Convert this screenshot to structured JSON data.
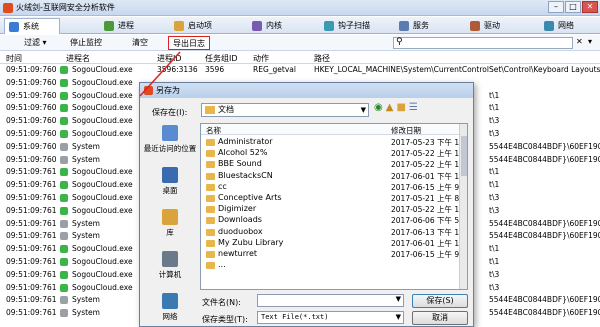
{
  "window": {
    "title": "火绒剑-互联网安全分析软件",
    "controls": [
      "–",
      "□",
      "✕"
    ]
  },
  "tabs": [
    {
      "label": "系统",
      "icon": "monitor-icon",
      "color": "#3a7bd5"
    },
    {
      "label": "进程",
      "icon": "process-icon",
      "color": "#4a9a3a"
    },
    {
      "label": "启动项",
      "icon": "startup-icon",
      "color": "#d9a43a"
    },
    {
      "label": "内核",
      "icon": "kernel-icon",
      "color": "#7a5ab0"
    },
    {
      "label": "钩子扫描",
      "icon": "hook-icon",
      "color": "#3a9ab0"
    },
    {
      "label": "服务",
      "icon": "service-icon",
      "color": "#5a7ab0"
    },
    {
      "label": "驱动",
      "icon": "driver-icon",
      "color": "#b05a3a"
    },
    {
      "label": "网络",
      "icon": "network-icon",
      "color": "#3a8ab0"
    }
  ],
  "toolbar": {
    "filter": "过滤 ▾",
    "stop": "停止监控",
    "clear": "清空",
    "export": "导出日志",
    "search_icon": "⚲",
    "search_clear": "✕",
    "search_options": "▾"
  },
  "columns": [
    "时间",
    "进程名",
    "进程ID",
    "任务组ID",
    "动作",
    "路径"
  ],
  "rows": [
    {
      "time": "09:51:09:760",
      "proc": "SogouCloud.exe",
      "pid": "3596:3136",
      "gid": "3596",
      "action": "REG_getval",
      "path": "HKEY_LOCAL_MACHINE\\System\\CurrentControlSet\\Control\\Keyboard Layouts\\",
      "icon": "#3bb54a"
    },
    {
      "time": "09:51:09:760",
      "proc": "SogouCloud.exe",
      "pid": "",
      "gid": "",
      "action": "",
      "path": "",
      "icon": "#3bb54a"
    },
    {
      "time": "09:51:09:760",
      "proc": "SogouCloud.exe",
      "pid": "",
      "gid": "",
      "action": "",
      "path": "t\\1",
      "icon": "#3bb54a"
    },
    {
      "time": "09:51:09:760",
      "proc": "SogouCloud.exe",
      "pid": "",
      "gid": "",
      "action": "",
      "path": "t\\1",
      "icon": "#3bb54a"
    },
    {
      "time": "09:51:09:760",
      "proc": "SogouCloud.exe",
      "pid": "",
      "gid": "",
      "action": "",
      "path": "t\\3",
      "icon": "#3bb54a"
    },
    {
      "time": "09:51:09:760",
      "proc": "SogouCloud.exe",
      "pid": "",
      "gid": "",
      "action": "",
      "path": "t\\3",
      "icon": "#3bb54a"
    },
    {
      "time": "09:51:09:760",
      "proc": "System",
      "pid": "",
      "gid": "",
      "action": "",
      "path": "5544E4BC0844BDF}\\60EF190592",
      "icon": "#9aa0a6"
    },
    {
      "time": "09:51:09:760",
      "proc": "System",
      "pid": "",
      "gid": "",
      "action": "",
      "path": "5544E4BC0844BDF}\\60EF190592",
      "icon": "#9aa0a6"
    },
    {
      "time": "09:51:09:761",
      "proc": "SogouCloud.exe",
      "pid": "",
      "gid": "",
      "action": "",
      "path": "t\\1",
      "icon": "#3bb54a"
    },
    {
      "time": "09:51:09:761",
      "proc": "SogouCloud.exe",
      "pid": "",
      "gid": "",
      "action": "",
      "path": "t\\1",
      "icon": "#3bb54a"
    },
    {
      "time": "09:51:09:761",
      "proc": "SogouCloud.exe",
      "pid": "",
      "gid": "",
      "action": "",
      "path": "t\\3",
      "icon": "#3bb54a"
    },
    {
      "time": "09:51:09:761",
      "proc": "SogouCloud.exe",
      "pid": "",
      "gid": "",
      "action": "",
      "path": "t\\3",
      "icon": "#3bb54a"
    },
    {
      "time": "09:51:09:761",
      "proc": "System",
      "pid": "",
      "gid": "",
      "action": "",
      "path": "5544E4BC0844BDF}\\60EF190592",
      "icon": "#9aa0a6"
    },
    {
      "time": "09:51:09:761",
      "proc": "System",
      "pid": "",
      "gid": "",
      "action": "",
      "path": "5544E4BC0844BDF}\\60EF190592",
      "icon": "#9aa0a6"
    },
    {
      "time": "09:51:09:761",
      "proc": "SogouCloud.exe",
      "pid": "",
      "gid": "",
      "action": "",
      "path": "t\\1",
      "icon": "#3bb54a"
    },
    {
      "time": "09:51:09:761",
      "proc": "SogouCloud.exe",
      "pid": "",
      "gid": "",
      "action": "",
      "path": "t\\1",
      "icon": "#3bb54a"
    },
    {
      "time": "09:51:09:761",
      "proc": "SogouCloud.exe",
      "pid": "",
      "gid": "",
      "action": "",
      "path": "t\\3",
      "icon": "#3bb54a"
    },
    {
      "time": "09:51:09:761",
      "proc": "SogouCloud.exe",
      "pid": "",
      "gid": "",
      "action": "",
      "path": "t\\3",
      "icon": "#3bb54a"
    },
    {
      "time": "09:51:09:761",
      "proc": "System",
      "pid": "",
      "gid": "",
      "action": "",
      "path": "5544E4BC0844BDF}\\60EF190592",
      "icon": "#9aa0a6"
    },
    {
      "time": "09:51:09:761",
      "proc": "System",
      "pid": "",
      "gid": "",
      "action": "",
      "path": "5544E4BC0844BDF}\\60EF190592",
      "icon": "#9aa0a6"
    }
  ],
  "dialog": {
    "title": "另存为",
    "save_in_label": "保存在(I):",
    "save_in_value": "文档",
    "nav_icons": [
      "back-icon",
      "up-folder-icon",
      "new-folder-icon",
      "view-menu-icon"
    ],
    "places": [
      {
        "label": "最近访问的位置",
        "icon": "recent-places-icon",
        "color": "#5a8ad0"
      },
      {
        "label": "桌面",
        "icon": "desktop-icon",
        "color": "#3a6ab0"
      },
      {
        "label": "库",
        "icon": "libraries-icon",
        "color": "#d9a43a"
      },
      {
        "label": "计算机",
        "icon": "computer-icon",
        "color": "#6a7a8a"
      },
      {
        "label": "网络",
        "icon": "network-icon",
        "color": "#3a7ab0"
      }
    ],
    "list_head": {
      "name": "名称",
      "date": "修改日期"
    },
    "files": [
      {
        "name": "Administrator",
        "date": "2017-05-23 下午 1"
      },
      {
        "name": "Alcohol 52%",
        "date": "2017-05-22 上午 1"
      },
      {
        "name": "BBE Sound",
        "date": "2017-05-22 上午 1"
      },
      {
        "name": "BluestacksCN",
        "date": "2017-06-01 下午 1"
      },
      {
        "name": "cc",
        "date": "2017-06-15 上午 9"
      },
      {
        "name": "Conceptive Arts",
        "date": "2017-05-21 上午 8"
      },
      {
        "name": "Digimizer",
        "date": "2017-05-22 上午 1"
      },
      {
        "name": "Downloads",
        "date": "2017-06-06 下午 5"
      },
      {
        "name": "duoduobox",
        "date": "2017-06-13 下午 1"
      },
      {
        "name": "My Zubu Library",
        "date": "2017-06-01 上午 1"
      },
      {
        "name": "newturret",
        "date": "2017-06-15 上午 9"
      },
      {
        "name": "...",
        "date": ""
      }
    ],
    "filename_label": "文件名(N):",
    "filename_value": "",
    "filetype_label": "保存类型(T):",
    "filetype_value": "Text File(*.txt)",
    "save_button": "保存(S)",
    "cancel_button": "取消"
  }
}
